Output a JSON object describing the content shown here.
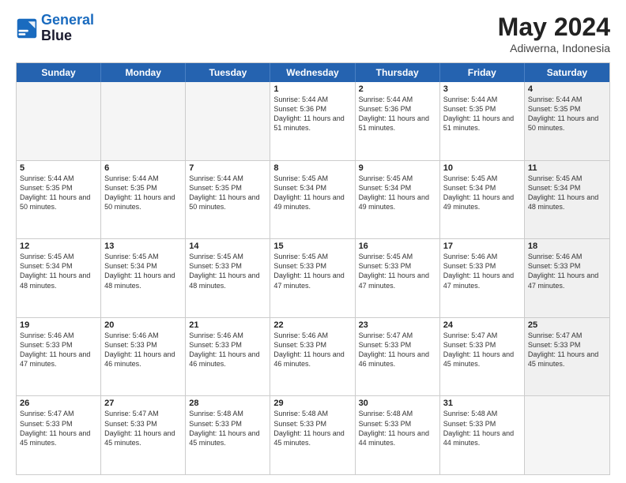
{
  "header": {
    "logo_line1": "General",
    "logo_line2": "Blue",
    "title": "May 2024",
    "subtitle": "Adiwerna, Indonesia"
  },
  "weekdays": [
    "Sunday",
    "Monday",
    "Tuesday",
    "Wednesday",
    "Thursday",
    "Friday",
    "Saturday"
  ],
  "weeks": [
    [
      {
        "day": "",
        "empty": true
      },
      {
        "day": "",
        "empty": true
      },
      {
        "day": "",
        "empty": true
      },
      {
        "day": "1",
        "sunrise": "5:44 AM",
        "sunset": "5:36 PM",
        "daylight": "11 hours and 51 minutes."
      },
      {
        "day": "2",
        "sunrise": "5:44 AM",
        "sunset": "5:36 PM",
        "daylight": "11 hours and 51 minutes."
      },
      {
        "day": "3",
        "sunrise": "5:44 AM",
        "sunset": "5:35 PM",
        "daylight": "11 hours and 51 minutes."
      },
      {
        "day": "4",
        "sunrise": "5:44 AM",
        "sunset": "5:35 PM",
        "daylight": "11 hours and 50 minutes.",
        "shaded": true
      }
    ],
    [
      {
        "day": "5",
        "sunrise": "5:44 AM",
        "sunset": "5:35 PM",
        "daylight": "11 hours and 50 minutes."
      },
      {
        "day": "6",
        "sunrise": "5:44 AM",
        "sunset": "5:35 PM",
        "daylight": "11 hours and 50 minutes."
      },
      {
        "day": "7",
        "sunrise": "5:44 AM",
        "sunset": "5:35 PM",
        "daylight": "11 hours and 50 minutes."
      },
      {
        "day": "8",
        "sunrise": "5:45 AM",
        "sunset": "5:34 PM",
        "daylight": "11 hours and 49 minutes."
      },
      {
        "day": "9",
        "sunrise": "5:45 AM",
        "sunset": "5:34 PM",
        "daylight": "11 hours and 49 minutes."
      },
      {
        "day": "10",
        "sunrise": "5:45 AM",
        "sunset": "5:34 PM",
        "daylight": "11 hours and 49 minutes."
      },
      {
        "day": "11",
        "sunrise": "5:45 AM",
        "sunset": "5:34 PM",
        "daylight": "11 hours and 48 minutes.",
        "shaded": true
      }
    ],
    [
      {
        "day": "12",
        "sunrise": "5:45 AM",
        "sunset": "5:34 PM",
        "daylight": "11 hours and 48 minutes."
      },
      {
        "day": "13",
        "sunrise": "5:45 AM",
        "sunset": "5:34 PM",
        "daylight": "11 hours and 48 minutes."
      },
      {
        "day": "14",
        "sunrise": "5:45 AM",
        "sunset": "5:33 PM",
        "daylight": "11 hours and 48 minutes."
      },
      {
        "day": "15",
        "sunrise": "5:45 AM",
        "sunset": "5:33 PM",
        "daylight": "11 hours and 47 minutes."
      },
      {
        "day": "16",
        "sunrise": "5:45 AM",
        "sunset": "5:33 PM",
        "daylight": "11 hours and 47 minutes."
      },
      {
        "day": "17",
        "sunrise": "5:46 AM",
        "sunset": "5:33 PM",
        "daylight": "11 hours and 47 minutes."
      },
      {
        "day": "18",
        "sunrise": "5:46 AM",
        "sunset": "5:33 PM",
        "daylight": "11 hours and 47 minutes.",
        "shaded": true
      }
    ],
    [
      {
        "day": "19",
        "sunrise": "5:46 AM",
        "sunset": "5:33 PM",
        "daylight": "11 hours and 47 minutes."
      },
      {
        "day": "20",
        "sunrise": "5:46 AM",
        "sunset": "5:33 PM",
        "daylight": "11 hours and 46 minutes."
      },
      {
        "day": "21",
        "sunrise": "5:46 AM",
        "sunset": "5:33 PM",
        "daylight": "11 hours and 46 minutes."
      },
      {
        "day": "22",
        "sunrise": "5:46 AM",
        "sunset": "5:33 PM",
        "daylight": "11 hours and 46 minutes."
      },
      {
        "day": "23",
        "sunrise": "5:47 AM",
        "sunset": "5:33 PM",
        "daylight": "11 hours and 46 minutes."
      },
      {
        "day": "24",
        "sunrise": "5:47 AM",
        "sunset": "5:33 PM",
        "daylight": "11 hours and 45 minutes."
      },
      {
        "day": "25",
        "sunrise": "5:47 AM",
        "sunset": "5:33 PM",
        "daylight": "11 hours and 45 minutes.",
        "shaded": true
      }
    ],
    [
      {
        "day": "26",
        "sunrise": "5:47 AM",
        "sunset": "5:33 PM",
        "daylight": "11 hours and 45 minutes."
      },
      {
        "day": "27",
        "sunrise": "5:47 AM",
        "sunset": "5:33 PM",
        "daylight": "11 hours and 45 minutes."
      },
      {
        "day": "28",
        "sunrise": "5:48 AM",
        "sunset": "5:33 PM",
        "daylight": "11 hours and 45 minutes."
      },
      {
        "day": "29",
        "sunrise": "5:48 AM",
        "sunset": "5:33 PM",
        "daylight": "11 hours and 45 minutes."
      },
      {
        "day": "30",
        "sunrise": "5:48 AM",
        "sunset": "5:33 PM",
        "daylight": "11 hours and 44 minutes."
      },
      {
        "day": "31",
        "sunrise": "5:48 AM",
        "sunset": "5:33 PM",
        "daylight": "11 hours and 44 minutes."
      },
      {
        "day": "",
        "empty": true,
        "shaded": true
      }
    ]
  ]
}
